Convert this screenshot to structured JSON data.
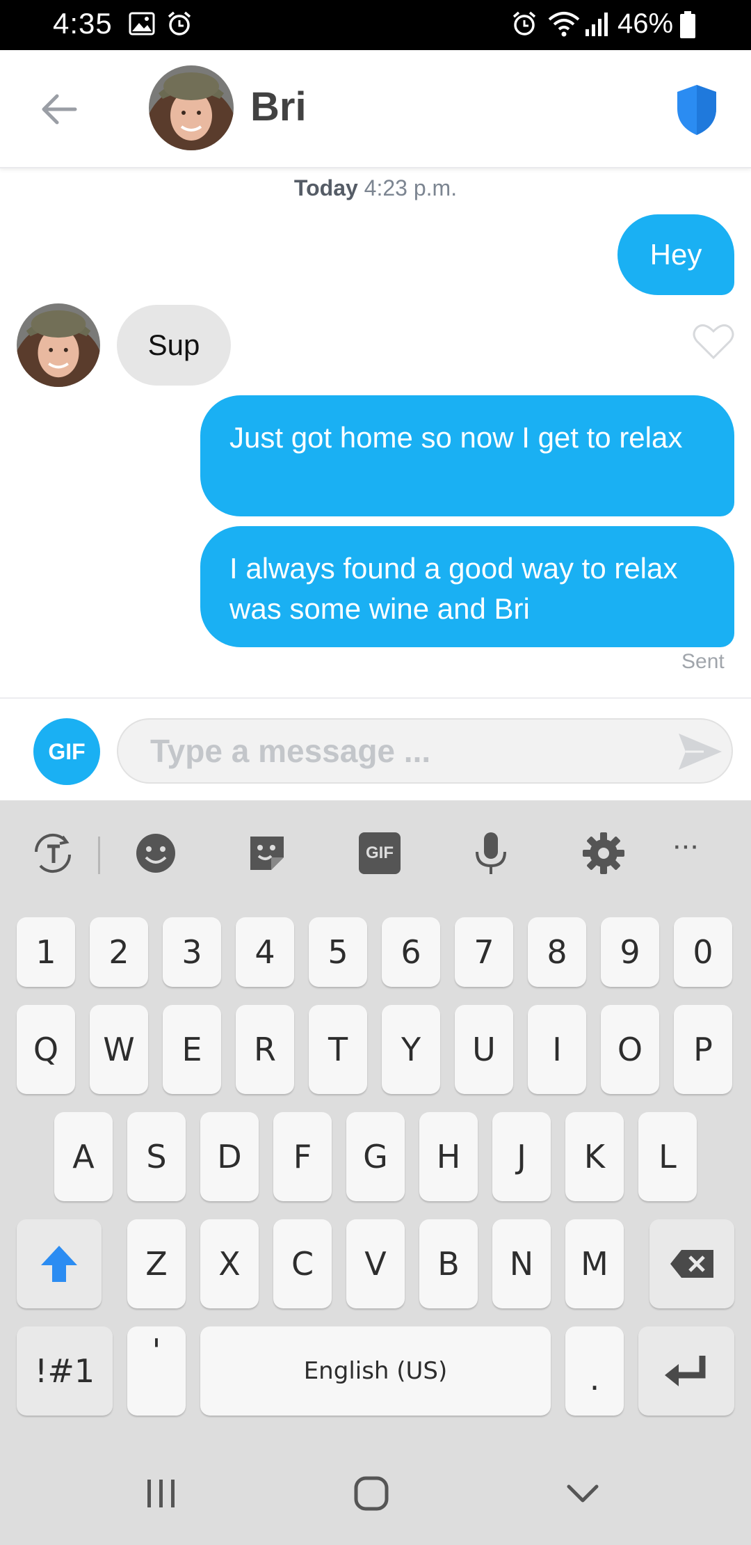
{
  "status_bar": {
    "time": "4:35",
    "battery_percent": "46%"
  },
  "header": {
    "contact_name": "Bri",
    "icons": [
      "back-arrow-icon",
      "shield-icon"
    ]
  },
  "conversation": {
    "timestamp_day": "Today",
    "timestamp_time": "4:23 p.m.",
    "messages": [
      {
        "direction": "out",
        "text": "Hey"
      },
      {
        "direction": "in",
        "text": "Sup"
      },
      {
        "direction": "out",
        "text": "Just got home so now I get to relax"
      },
      {
        "direction": "out",
        "text": "I always found a good way to relax was some wine and Bri"
      }
    ],
    "sent_status": "Sent"
  },
  "composer": {
    "gif_label": "GIF",
    "placeholder": "Type a message ..."
  },
  "keyboard": {
    "toolbar_gif_label": "GIF",
    "toolbar_more": "···",
    "row_numbers": [
      "1",
      "2",
      "3",
      "4",
      "5",
      "6",
      "7",
      "8",
      "9",
      "0"
    ],
    "row_1": [
      "Q",
      "W",
      "E",
      "R",
      "T",
      "Y",
      "U",
      "I",
      "O",
      "P"
    ],
    "row_2": [
      "A",
      "S",
      "D",
      "F",
      "G",
      "H",
      "J",
      "K",
      "L"
    ],
    "row_3": [
      "Z",
      "X",
      "C",
      "V",
      "B",
      "N",
      "M"
    ],
    "symbols_label": "!#1",
    "apostrophe_label": "'",
    "space_label": "English (US)",
    "period_label": "."
  },
  "colors": {
    "accent_blue": "#1ab0f3",
    "incoming_bubble": "#e6e6e6",
    "shield_blue": "#2b8cf2",
    "keyboard_bg": "#dddddd"
  }
}
